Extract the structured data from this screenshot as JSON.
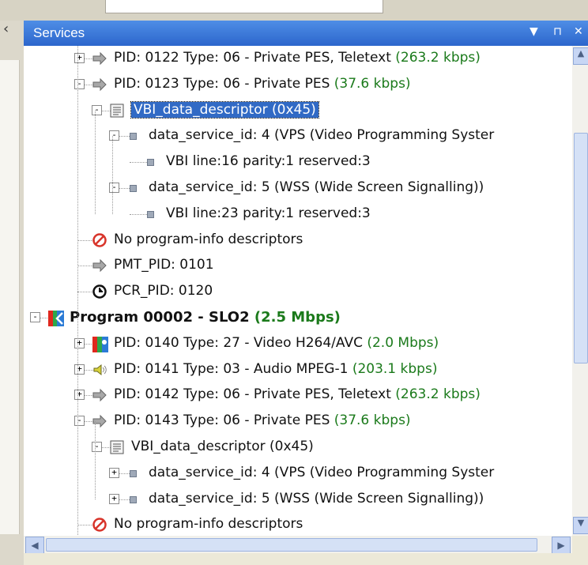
{
  "panel": {
    "title": "Services",
    "buttons": {
      "dropdown": "▼",
      "pin": "⊓",
      "close": "✕"
    }
  },
  "tree": [
    {
      "indent": 2,
      "toggle": "+",
      "icon": "arrow-icon",
      "text": "PID: 0122  Type: 06 - Private PES, Teletext ",
      "rate": "(263.2 kbps)"
    },
    {
      "indent": 2,
      "toggle": "-",
      "icon": "arrow-icon",
      "text": "PID: 0123  Type: 06 - Private PES ",
      "rate": "(37.6 kbps)"
    },
    {
      "indent": 3,
      "toggle": "-",
      "icon": "descriptor-icon",
      "text": "VBI_data_descriptor (0x45)",
      "rate": "",
      "selected": true
    },
    {
      "indent": 4,
      "toggle": "-",
      "icon": "dot",
      "text": "data_service_id: 4 (VPS (Video Programming Syster",
      "rate": ""
    },
    {
      "indent": 5,
      "toggle": "",
      "icon": "dot",
      "text": "VBI line:16 parity:1 reserved:3",
      "rate": ""
    },
    {
      "indent": 4,
      "toggle": "-",
      "icon": "dot",
      "text": "data_service_id: 5 (WSS (Wide Screen Signalling))",
      "rate": ""
    },
    {
      "indent": 5,
      "toggle": "",
      "icon": "dot",
      "text": "VBI line:23 parity:1 reserved:3",
      "rate": ""
    },
    {
      "indent": 2,
      "toggle": "",
      "icon": "no-icon",
      "text": "No program-info descriptors",
      "rate": ""
    },
    {
      "indent": 2,
      "toggle": "",
      "icon": "arrow-icon",
      "text": "PMT_PID: 0101",
      "rate": ""
    },
    {
      "indent": 2,
      "toggle": "",
      "icon": "clock-icon",
      "text": "PCR_PID: 0120",
      "rate": ""
    },
    {
      "indent": 0,
      "toggle": "-",
      "icon": "program-icon",
      "text": "Program 00002 - SLO2 ",
      "rate": "(2.5 Mbps)",
      "bold": true
    },
    {
      "indent": 2,
      "toggle": "+",
      "icon": "video-icon",
      "text": "PID: 0140  Type: 27 - Video H264/AVC ",
      "rate": "(2.0 Mbps)"
    },
    {
      "indent": 2,
      "toggle": "+",
      "icon": "audio-icon",
      "text": "PID: 0141  Type: 03 - Audio MPEG-1 ",
      "rate": "(203.1 kbps)"
    },
    {
      "indent": 2,
      "toggle": "+",
      "icon": "arrow-icon",
      "text": "PID: 0142  Type: 06 - Private PES, Teletext ",
      "rate": "(263.2 kbps)"
    },
    {
      "indent": 2,
      "toggle": "-",
      "icon": "arrow-icon",
      "text": "PID: 0143  Type: 06 - Private PES ",
      "rate": "(37.6 kbps)"
    },
    {
      "indent": 3,
      "toggle": "-",
      "icon": "descriptor-icon",
      "text": "VBI_data_descriptor (0x45)",
      "rate": ""
    },
    {
      "indent": 4,
      "toggle": "+",
      "icon": "dot",
      "text": "data_service_id: 4 (VPS (Video Programming Syster",
      "rate": ""
    },
    {
      "indent": 4,
      "toggle": "+",
      "icon": "dot",
      "text": "data_service_id: 5 (WSS (Wide Screen Signalling))",
      "rate": ""
    },
    {
      "indent": 2,
      "toggle": "",
      "icon": "no-icon",
      "text": "No program-info descriptors",
      "rate": ""
    }
  ],
  "colors": {
    "titlebar": "#2c66cc",
    "selection": "#316ac5",
    "bitrate": "#1b7a1b"
  }
}
